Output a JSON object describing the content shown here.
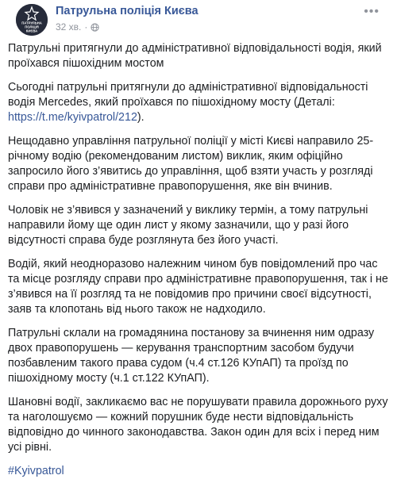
{
  "page": {
    "name": "Патрульна поліція Києва",
    "timestamp": "32 хв.",
    "logo_text": [
      "ПАТРУЛЬНА",
      "ПОЛІЦІЯ",
      "КИЄВА"
    ]
  },
  "post": {
    "p1": "Патрульні притягнули до адміністративної відповідальності водія, який проїхався пішохідним мостом",
    "p2_pre": "Сьогодні патрульні притягнули до адміністративної відповідальності водія Mercedes, який проїхався по пішохідному мосту (Деталі: ",
    "p2_link": "https://t.me/kyivpatrol/212",
    "p2_post": ").",
    "p3": "Нещодавно управління патрульної поліції у місті Києві направило 25-річному водію (рекомендованим листом) виклик, яким офіційно запросило його з’явитись до управління, щоб взяти участь у розгляді справи про адміністративне правопорушення, яке він вчинив.",
    "p4": "Чоловік не з’явився у зазначений у виклику термін, а тому патрульні направили йому ще один лист у якому зазначили, що у разі його відсутності справа буде розглянута без його участі.",
    "p5": "Водій, який неодноразово належним чином був повідомлений про час та місце розгляду справи про адміністративне правопорушення, так і не з’явився на її розгляд та не повідомив про причини своєї відсутності, заяв та клопотань від нього також не надходило.",
    "p6": "Патрульні склали на громадянина постанову за вчинення ним одразу двох правопорушень — керування транспортним засобом будучи позбавленим такого права судом (ч.4 ст.126 КУпАП) та проїзд по пішохідному мосту (ч.1 ст.122 КУпАП).",
    "p7": "Шановні водії, закликаємо вас не порушувати правила дорожнього руху та наголошуємо — кожний порушник буде нести відповідальність відповідно до чинного законодавства. Закон один для всіх і перед ним усі рівні.",
    "hashtag": "#Kyivpatrol"
  },
  "colors": {
    "link": "#385898",
    "meta": "#90949c",
    "text": "#1c1e21",
    "avatar_bg": "#262b3a"
  },
  "icons": [
    "police-logo-icon",
    "globe-icon",
    "more-icon"
  ]
}
